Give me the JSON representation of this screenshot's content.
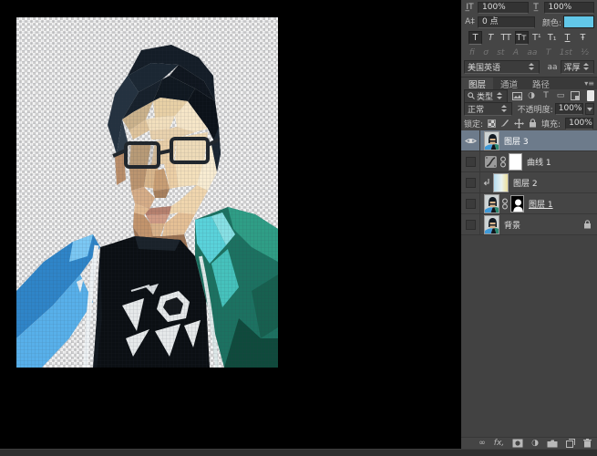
{
  "character_panel": {
    "vertical_scale_value": "100%",
    "horizontal_scale_value": "100%",
    "baseline_value": "0 点",
    "color_label": "颜色:",
    "swatch_color": "#62c7e8",
    "style_buttons": [
      {
        "label": "T",
        "active": true
      },
      {
        "label": "T",
        "active": false
      },
      {
        "label": "TT",
        "active": false
      },
      {
        "label": "Tᴛ",
        "active": true
      },
      {
        "label": "T¹",
        "active": false
      },
      {
        "label": "T₁",
        "active": false
      },
      {
        "label": "T",
        "active": false
      },
      {
        "label": "Ŧ",
        "active": false
      }
    ],
    "opentype": [
      "fi",
      "ơ",
      "st",
      "A",
      "aa",
      "T",
      "1st",
      "½"
    ],
    "language": "美国英语",
    "anti_alias_label": "aa",
    "anti_alias_value": "浑厚"
  },
  "panel_tabs": {
    "layers": "图层",
    "channels": "通道",
    "paths": "路径"
  },
  "layers_panel": {
    "filter_label": "类型",
    "blend_mode": "正常",
    "opacity_label": "不透明度:",
    "opacity_value": "100%",
    "lock_label": "锁定:",
    "fill_label": "填充:",
    "fill_value": "100%",
    "layers": [
      {
        "name": "图层 3",
        "visible": true,
        "selected": true,
        "type": "image"
      },
      {
        "name": "曲线 1",
        "visible": false,
        "type": "curves-adjustment",
        "has_mask": true
      },
      {
        "name": "图层 2",
        "visible": false,
        "type": "gradient",
        "clipped": true
      },
      {
        "name": "图层 1",
        "visible": false,
        "type": "image",
        "has_mask": true
      },
      {
        "name": "背景",
        "visible": false,
        "type": "image",
        "locked": true
      }
    ]
  },
  "icons": {
    "link": "∞",
    "fx": "fx,",
    "adjustment_circle": "◑",
    "panel_menu": "▾≡",
    "type_filter_t": "T",
    "shape_filter": "▭"
  }
}
